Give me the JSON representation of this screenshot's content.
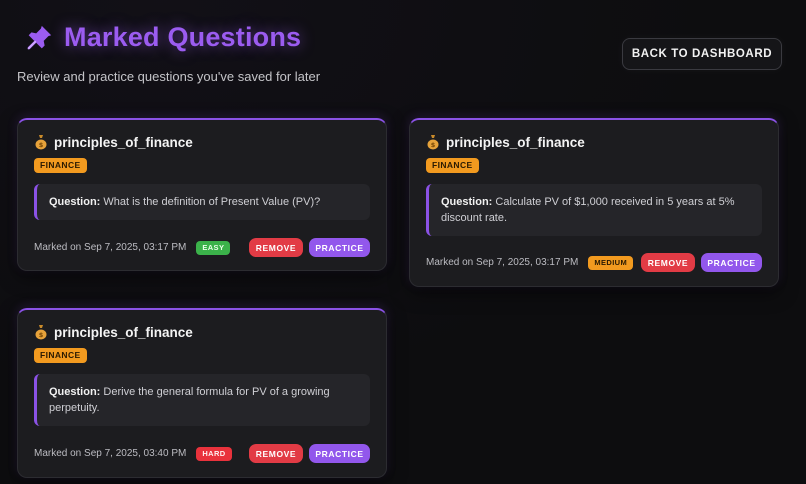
{
  "header": {
    "title": "Marked Questions",
    "subtitle": "Review and practice questions you've saved for later",
    "back_button_label": "BACK TO DASHBOARD"
  },
  "colors": {
    "accent": "#9b5cf0",
    "tag_finance": "#f29a1f",
    "easy": "#3bb24a",
    "medium": "#f29a1f",
    "hard": "#e9323c",
    "remove": "#e23b45",
    "practice": "#9257ec"
  },
  "icons": {
    "title": "pushpin-icon",
    "topic": "money-bag-icon"
  },
  "cards": [
    {
      "topic": "principles_of_finance",
      "tag": "FINANCE",
      "question_label": "Question:",
      "question_text": "What is the definition of Present Value (PV)?",
      "marked": "Marked on Sep 7, 2025, 03:17 PM",
      "difficulty": "EASY",
      "remove_label": "REMOVE",
      "practice_label": "PRACTICE"
    },
    {
      "topic": "principles_of_finance",
      "tag": "FINANCE",
      "question_label": "Question:",
      "question_text": "Calculate PV of $1,000 received in 5 years at 5% discount rate.",
      "marked": "Marked on Sep 7, 2025, 03:17 PM",
      "difficulty": "MEDIUM",
      "remove_label": "REMOVE",
      "practice_label": "PRACTICE"
    },
    {
      "topic": "principles_of_finance",
      "tag": "FINANCE",
      "question_label": "Question:",
      "question_text": "Derive the general formula for PV of a growing perpetuity.",
      "marked": "Marked on Sep 7, 2025, 03:40 PM",
      "difficulty": "HARD",
      "remove_label": "REMOVE",
      "practice_label": "PRACTICE"
    }
  ]
}
